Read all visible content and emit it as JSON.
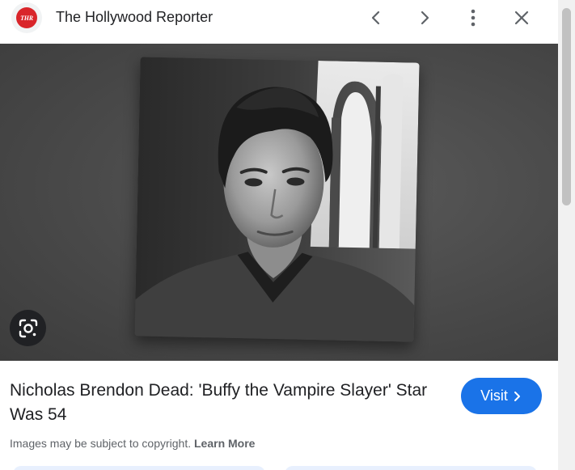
{
  "header": {
    "favicon_text": "THR",
    "site_name": "The Hollywood Reporter",
    "prev_icon": "chevron-left-icon",
    "next_icon": "chevron-right-icon",
    "more_icon": "more-vert-icon",
    "close_icon": "close-icon"
  },
  "image": {
    "lens_icon": "google-lens-icon"
  },
  "result": {
    "title": "Nicholas Brendon Dead: 'Buffy the Vampire Slayer' Star Was 54",
    "visit_label": "Visit",
    "copyright_text": "Images may be subject to copyright.",
    "learn_more": "Learn More"
  },
  "colors": {
    "accent": "#1a73e8",
    "favicon_red": "#d9252a"
  }
}
